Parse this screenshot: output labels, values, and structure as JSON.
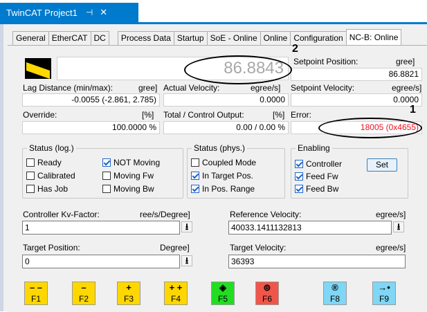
{
  "document_tab": {
    "title": "TwinCAT Project1",
    "pin": "⊣",
    "close": "✕"
  },
  "tabs": [
    "General",
    "EtherCAT",
    "DC",
    "Process Data",
    "Startup",
    "SoE - Online",
    "Online",
    "Configuration",
    "NC-B: Online"
  ],
  "big_position": "86.8843",
  "setpoint_position": {
    "label": "Setpoint Position:",
    "unit": "gree]",
    "value": "86.8821"
  },
  "lag_distance": {
    "label": "Lag Distance (min/max):",
    "unit": "gree]",
    "value": "-0.0055  (-2.861, 2.785)"
  },
  "actual_velocity": {
    "label": "Actual Velocity:",
    "unit": "egree/s]",
    "value": "0.0000"
  },
  "setpoint_velocity": {
    "label": "Setpoint Velocity:",
    "unit": "egree/s]",
    "value": "0.0000"
  },
  "override": {
    "label": "Override:",
    "unit": "[%]",
    "value": "100.0000 %"
  },
  "total_output": {
    "label": "Total / Control Output:",
    "unit": "[%]",
    "value": "0.00 /  0.00 %"
  },
  "error": {
    "label": "Error:",
    "value": "18005 (0x4655)",
    "color": "#e81123"
  },
  "status_log": {
    "title": "Status (log.)",
    "items": [
      {
        "label": "Ready",
        "checked": false
      },
      {
        "label": "Calibrated",
        "checked": false
      },
      {
        "label": "Has Job",
        "checked": false
      },
      {
        "label": "NOT Moving",
        "checked": true
      },
      {
        "label": "Moving Fw",
        "checked": false
      },
      {
        "label": "Moving Bw",
        "checked": false
      }
    ]
  },
  "status_phys": {
    "title": "Status (phys.)",
    "items": [
      {
        "label": "Coupled Mode",
        "checked": false
      },
      {
        "label": "In Target Pos.",
        "checked": true
      },
      {
        "label": "In Pos. Range",
        "checked": true
      }
    ]
  },
  "enabling": {
    "title": "Enabling",
    "items": [
      {
        "label": "Controller",
        "checked": true
      },
      {
        "label": "Feed Fw",
        "checked": true
      },
      {
        "label": "Feed Bw",
        "checked": true
      }
    ],
    "set_button": "Set"
  },
  "kv_factor": {
    "label": "Controller Kv-Factor:",
    "unit": "ree/s/Degree]",
    "value": "1"
  },
  "reference_velocity": {
    "label": "Reference Velocity:",
    "unit": "egree/s]",
    "value": "40033.1411132813"
  },
  "target_position": {
    "label": "Target Position:",
    "unit": "Degree]",
    "value": "0"
  },
  "target_velocity": {
    "label": "Target Velocity:",
    "unit": "egree/s]",
    "value": "36393"
  },
  "download_icon": "⭳",
  "fkeys": [
    {
      "key": "F1",
      "icon": "– –",
      "color": "#ffd700"
    },
    {
      "key": "F2",
      "icon": "–",
      "color": "#ffd700"
    },
    {
      "key": "F3",
      "icon": "+",
      "color": "#ffd700"
    },
    {
      "key": "F4",
      "icon": "+ +",
      "color": "#ffd700"
    },
    {
      "key": "F5",
      "icon": "◈",
      "color": "#22dd22"
    },
    {
      "key": "F6",
      "icon": "⊚",
      "color": "#f0554a"
    },
    {
      "key": "F8",
      "icon": "®",
      "color": "#7fd6f5"
    },
    {
      "key": "F9",
      "icon": "→•",
      "color": "#7fd6f5"
    }
  ],
  "annotations": [
    "1",
    "2"
  ]
}
